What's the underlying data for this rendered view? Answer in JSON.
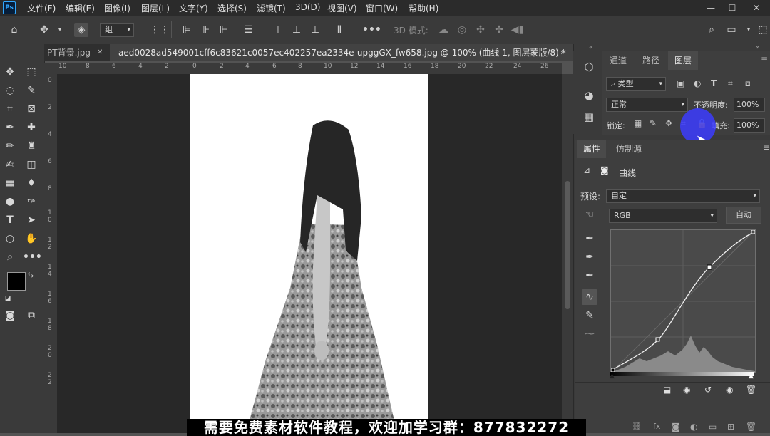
{
  "app": {
    "logo": "Ps"
  },
  "menu": [
    "文件(F)",
    "编辑(E)",
    "图像(I)",
    "图层(L)",
    "文字(Y)",
    "选择(S)",
    "滤镜(T)",
    "3D(D)",
    "视图(V)",
    "窗口(W)",
    "帮助(H)"
  ],
  "window_controls": {
    "minimize": "—",
    "maximize": "☐",
    "close": "✕"
  },
  "options_bar": {
    "auto_select_target": "组",
    "mode_3d_label": "3D 模式:"
  },
  "tabs": [
    {
      "label": "PT背景.jpg",
      "close": "✕"
    },
    {
      "label": "aed0028ad549001cff6c83621c0057ec402257ea2334e-upggGX_fw658.jpg @ 100% (曲线 1, 图层蒙版/8) *",
      "close": "✕"
    }
  ],
  "ruler_h": [
    "10",
    "8",
    "6",
    "4",
    "2",
    "0",
    "2",
    "4",
    "6",
    "8",
    "10",
    "12",
    "14",
    "16",
    "18",
    "20",
    "22",
    "24",
    "26"
  ],
  "ruler_v": [
    "0",
    "2",
    "4",
    "6",
    "8",
    "1\n0",
    "1\n2",
    "1\n4",
    "1\n6",
    "1\n8",
    "2\n0",
    "2\n2"
  ],
  "layers_panel": {
    "tabs": [
      "通道",
      "路径",
      "图层"
    ],
    "filter_kind": "类型",
    "blend_mode": "正常",
    "opacity_label": "不透明度:",
    "opacity_value": "100%",
    "lock_label": "锁定:",
    "fill_label": "填充:",
    "fill_value": "100%"
  },
  "properties_panel": {
    "tabs": [
      "属性",
      "仿制源"
    ],
    "adjustment_name": "曲线",
    "preset_label": "预设:",
    "preset_value": "自定",
    "channel_value": "RGB",
    "auto_button": "自动"
  },
  "subtitle": "需要免费素材软件教程，欢迎加学习群：877832272",
  "colors": {
    "accent": "#31a8ff",
    "cursor_highlight": "#3c3cff",
    "lock_active": "#f2c744"
  }
}
